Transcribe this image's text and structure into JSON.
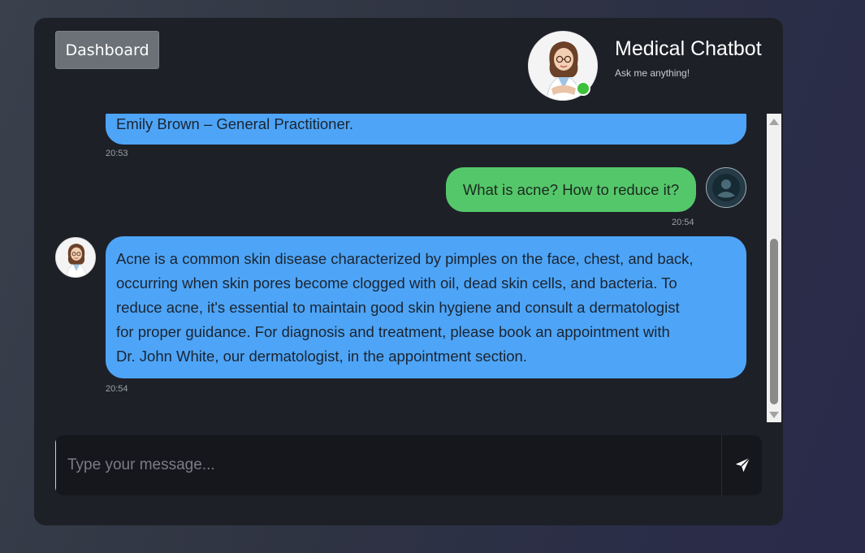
{
  "header": {
    "dashboard_label": "Dashboard",
    "title": "Medical Chatbot",
    "subtitle": "Ask me anything!",
    "status": "online",
    "status_color": "#3ec13a"
  },
  "messages": [
    {
      "sender": "bot",
      "text": "Emily Brown – General Practitioner.",
      "time": "20:53"
    },
    {
      "sender": "user",
      "text": "What is acne? How to reduce it?",
      "time": "20:54"
    },
    {
      "sender": "bot",
      "lines": [
        "Acne is a common skin disease characterized by pimples on the face, chest, and back,",
        "occurring when skin pores become clogged with oil, dead skin cells, and bacteria. To",
        "reduce acne, it's essential to maintain good skin hygiene and consult a dermatologist",
        "for proper guidance. For diagnosis and treatment, please book an appointment with",
        "Dr. John White, our dermatologist, in the appointment section."
      ],
      "time": "20:54"
    }
  ],
  "composer": {
    "placeholder": "Type your message...",
    "value": "",
    "send_icon": "send-icon"
  },
  "colors": {
    "bot_bubble": "#4ea5f7",
    "user_bubble": "#54c76a",
    "card_bg": "#1e2028"
  }
}
